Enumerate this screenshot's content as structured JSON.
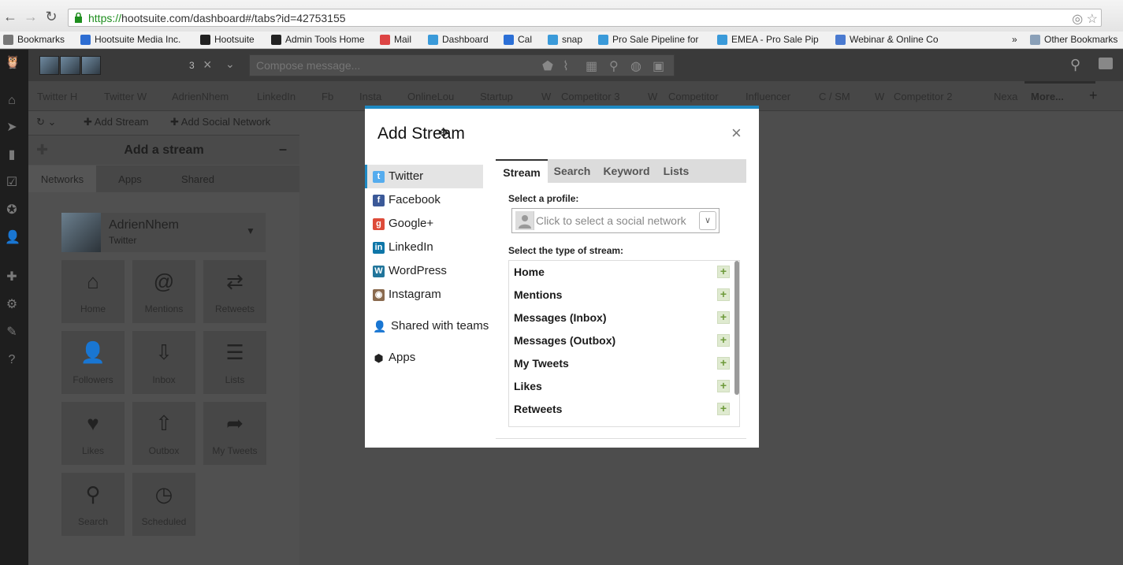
{
  "browser": {
    "url_https": "https://",
    "url_rest": "hootsuite.com/dashboard#/tabs?id=42753155",
    "bookmarks": [
      {
        "label": "Bookmarks",
        "icon": "star-icon"
      },
      {
        "label": "Hootsuite Media Inc.",
        "icon": "site-icon"
      },
      {
        "label": "Hootsuite",
        "icon": "owl-icon"
      },
      {
        "label": "Admin Tools Home",
        "icon": "owl-icon"
      },
      {
        "label": "Mail",
        "icon": "gmail-icon"
      },
      {
        "label": "Dashboard",
        "icon": "salesforce-icon"
      },
      {
        "label": "Cal",
        "icon": "calendar-icon"
      },
      {
        "label": "snap",
        "icon": "snap-icon"
      },
      {
        "label": "Pro Sale Pipeline for",
        "icon": "salesforce-icon"
      },
      {
        "label": "EMEA - Pro Sale Pip",
        "icon": "salesforce-icon"
      },
      {
        "label": "Webinar & Online Co",
        "icon": "webinar-icon"
      },
      {
        "label": "»",
        "icon": ""
      },
      {
        "label": "Other Bookmarks",
        "icon": "folder-icon"
      }
    ]
  },
  "compose": {
    "count": "3",
    "placeholder": "Compose message..."
  },
  "tabs": [
    "Twitter H",
    "Twitter W",
    "AdrienNhem",
    "LinkedIn",
    "Fb",
    "Insta",
    "OnlineLou",
    "Startup",
    "W",
    "Competitor 3",
    "W",
    "Competitor",
    "Influencer",
    "C / SM",
    "W",
    "Competitor 2",
    "Nexa",
    "More..."
  ],
  "column_toolbar": {
    "add_stream": "Add Stream",
    "add_social_network": "Add Social Network"
  },
  "add_stream_panel": {
    "title": "Add a stream",
    "tabs": [
      "Networks",
      "Apps",
      "Shared"
    ],
    "profile_name": "AdrienNhem",
    "profile_network": "Twitter",
    "tiles": [
      {
        "label": "Home",
        "icon": "home-icon"
      },
      {
        "label": "Mentions",
        "icon": "at-icon"
      },
      {
        "label": "Retweets",
        "icon": "retweet-icon"
      },
      {
        "label": "Followers",
        "icon": "add-user-icon"
      },
      {
        "label": "Inbox",
        "icon": "inbox-icon"
      },
      {
        "label": "Lists",
        "icon": "list-icon"
      },
      {
        "label": "Likes",
        "icon": "heart-icon"
      },
      {
        "label": "Outbox",
        "icon": "outbox-icon"
      },
      {
        "label": "My Tweets",
        "icon": "share-arrow-icon"
      },
      {
        "label": "Search",
        "icon": "search-icon"
      },
      {
        "label": "Scheduled",
        "icon": "clock-icon"
      }
    ]
  },
  "modal": {
    "title": "Add Stream",
    "networks": [
      {
        "label": "Twitter",
        "color": "#55acee",
        "glyph": "t"
      },
      {
        "label": "Facebook",
        "color": "#3b5998",
        "glyph": "f"
      },
      {
        "label": "Google+",
        "color": "#dd4b39",
        "glyph": "g"
      },
      {
        "label": "LinkedIn",
        "color": "#0e76a8",
        "glyph": "in"
      },
      {
        "label": "WordPress",
        "color": "#21759b",
        "glyph": "W"
      },
      {
        "label": "Instagram",
        "color": "#8a6a4e",
        "glyph": "◉"
      },
      {
        "label": "Shared with teams",
        "color": "",
        "glyph": ""
      },
      {
        "label": "Apps",
        "color": "",
        "glyph": ""
      }
    ],
    "stream_tabs": [
      "Stream",
      "Search",
      "Keyword",
      "Lists"
    ],
    "profile_label": "Select a profile:",
    "profile_placeholder": "Click to select a social network",
    "type_label": "Select the type of stream:",
    "stream_types": [
      "Home",
      "Mentions",
      "Messages (Inbox)",
      "Messages (Outbox)",
      "My Tweets",
      "Likes",
      "Retweets"
    ]
  }
}
